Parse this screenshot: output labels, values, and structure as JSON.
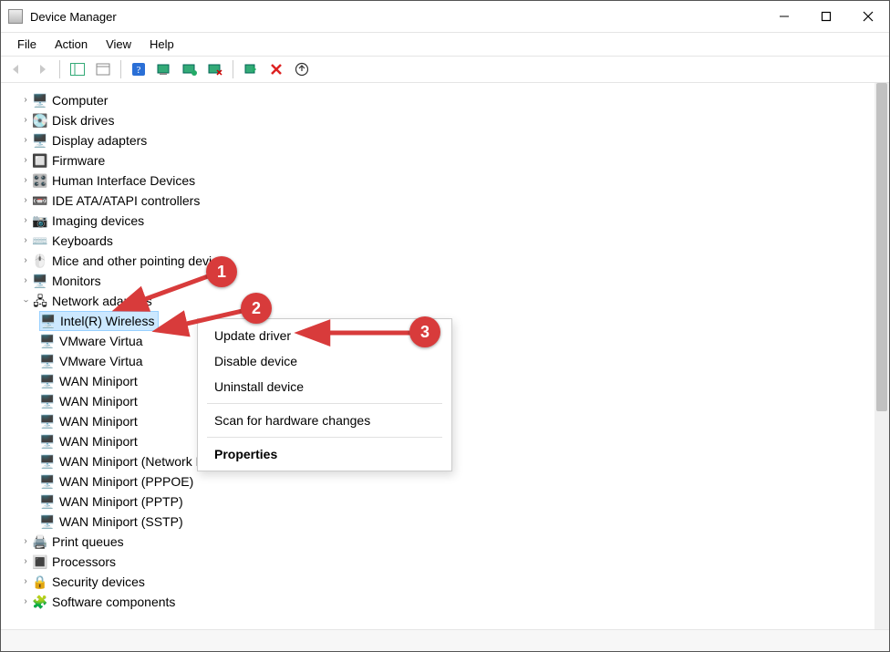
{
  "window": {
    "title": "Device Manager"
  },
  "menu": {
    "file": "File",
    "action": "Action",
    "view": "View",
    "help": "Help"
  },
  "tree": {
    "items": [
      {
        "label": "Computer",
        "icon": "computer-icon"
      },
      {
        "label": "Disk drives",
        "icon": "disk-icon"
      },
      {
        "label": "Display adapters",
        "icon": "display-icon"
      },
      {
        "label": "Firmware",
        "icon": "firmware-icon"
      },
      {
        "label": "Human Interface Devices",
        "icon": "hid-icon"
      },
      {
        "label": "IDE ATA/ATAPI controllers",
        "icon": "ide-icon"
      },
      {
        "label": "Imaging devices",
        "icon": "imaging-icon"
      },
      {
        "label": "Keyboards",
        "icon": "keyboard-icon"
      },
      {
        "label": "Mice and other pointing devices",
        "icon": "mouse-icon"
      },
      {
        "label": "Monitors",
        "icon": "monitor-icon"
      }
    ],
    "expanded": {
      "label": "Network adapters",
      "icon": "network-icon",
      "children": [
        {
          "label": "Intel(R) Wireless",
          "selected": true
        },
        {
          "label": "VMware Virtua"
        },
        {
          "label": "VMware Virtua"
        },
        {
          "label": "WAN Miniport"
        },
        {
          "label": "WAN Miniport"
        },
        {
          "label": "WAN Miniport"
        },
        {
          "label": "WAN Miniport"
        },
        {
          "label": "WAN Miniport (Network Monitor)"
        },
        {
          "label": "WAN Miniport (PPPOE)"
        },
        {
          "label": "WAN Miniport (PPTP)"
        },
        {
          "label": "WAN Miniport (SSTP)"
        }
      ]
    },
    "after": [
      {
        "label": "Print queues",
        "icon": "printer-icon"
      },
      {
        "label": "Processors",
        "icon": "cpu-icon"
      },
      {
        "label": "Security devices",
        "icon": "security-icon"
      },
      {
        "label": "Software components",
        "icon": "software-icon"
      }
    ]
  },
  "context_menu": {
    "update": "Update driver",
    "disable": "Disable device",
    "uninstall": "Uninstall device",
    "scan": "Scan for hardware changes",
    "properties": "Properties"
  },
  "annotations": {
    "badge1": "1",
    "badge2": "2",
    "badge3": "3"
  }
}
